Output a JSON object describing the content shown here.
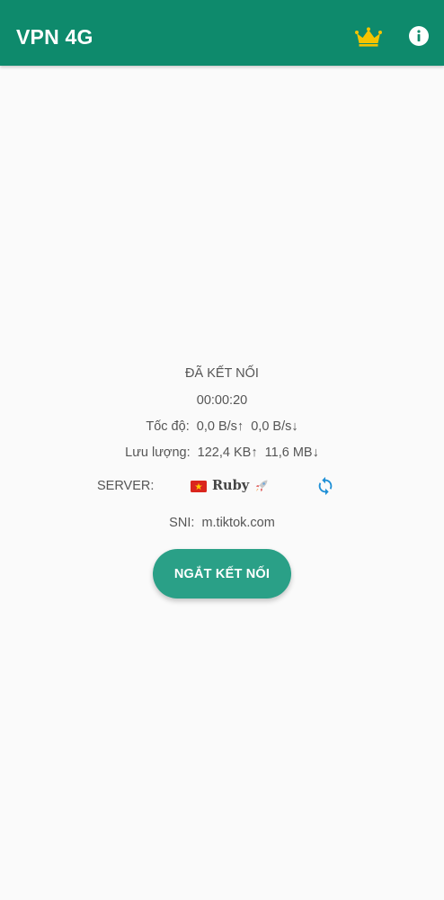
{
  "app_bar": {
    "title": "VPN 4G",
    "premium_icon": "crown-icon",
    "info_icon": "info-icon",
    "color": "#0e8a6c",
    "crown_color": "#f5c400"
  },
  "status": {
    "state": "ĐÃ KẾT NỐI",
    "timer": "00:00:20",
    "speed_label": "Tốc độ:",
    "speed_up": "0,0 B/s↑",
    "speed_down": "0,0 B/s↓",
    "traffic_label": "Lưu lượng:",
    "traffic_up": "122,4 KB↑",
    "traffic_down": "11,6 MB↓"
  },
  "server": {
    "label": "SERVER:",
    "name": "Ruby",
    "flag_icon": "vietnam-flag-icon",
    "rocket_icon": "rocket-icon",
    "refresh_icon": "refresh-icon",
    "refresh_color": "#1e8fd6"
  },
  "sni": {
    "label": "SNI:",
    "value": "m.tiktok.com"
  },
  "disconnect_button": {
    "label": "NGẮT KẾT NỐI",
    "color": "#2aa087"
  }
}
